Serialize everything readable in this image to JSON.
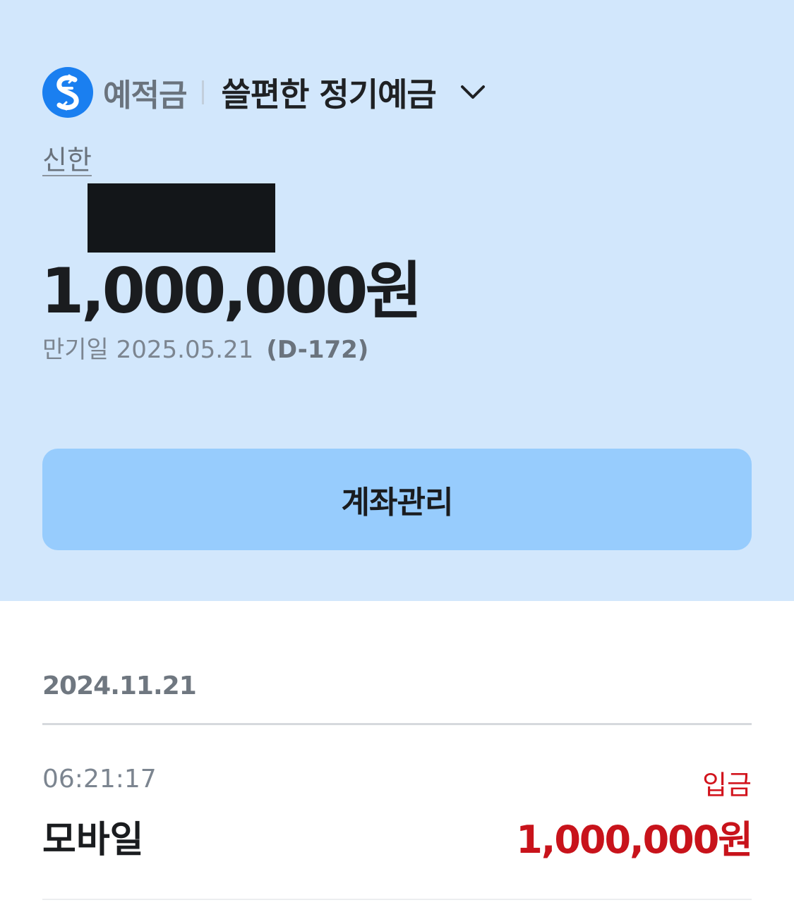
{
  "account": {
    "category": "예적금",
    "product_name": "쓸편한 정기예금",
    "bank": "신한",
    "balance": "1,000,000원",
    "maturity_label": "만기일 2025.05.21",
    "dday": "(D-172)",
    "logo_icon": "shinhan-logo-icon",
    "dropdown_icon": "chevron-down-icon"
  },
  "actions": {
    "manage_label": "계좌관리"
  },
  "transactions": {
    "date": "2024.11.21",
    "items": [
      {
        "time": "06:21:17",
        "type": "입금",
        "description": "모바일",
        "amount": "1,000,000원"
      }
    ]
  },
  "colors": {
    "header_bg": "#d2e7fc",
    "button_bg": "#97ccfd",
    "brand_blue": "#1a7ff0",
    "deposit_red": "#d2141d"
  }
}
